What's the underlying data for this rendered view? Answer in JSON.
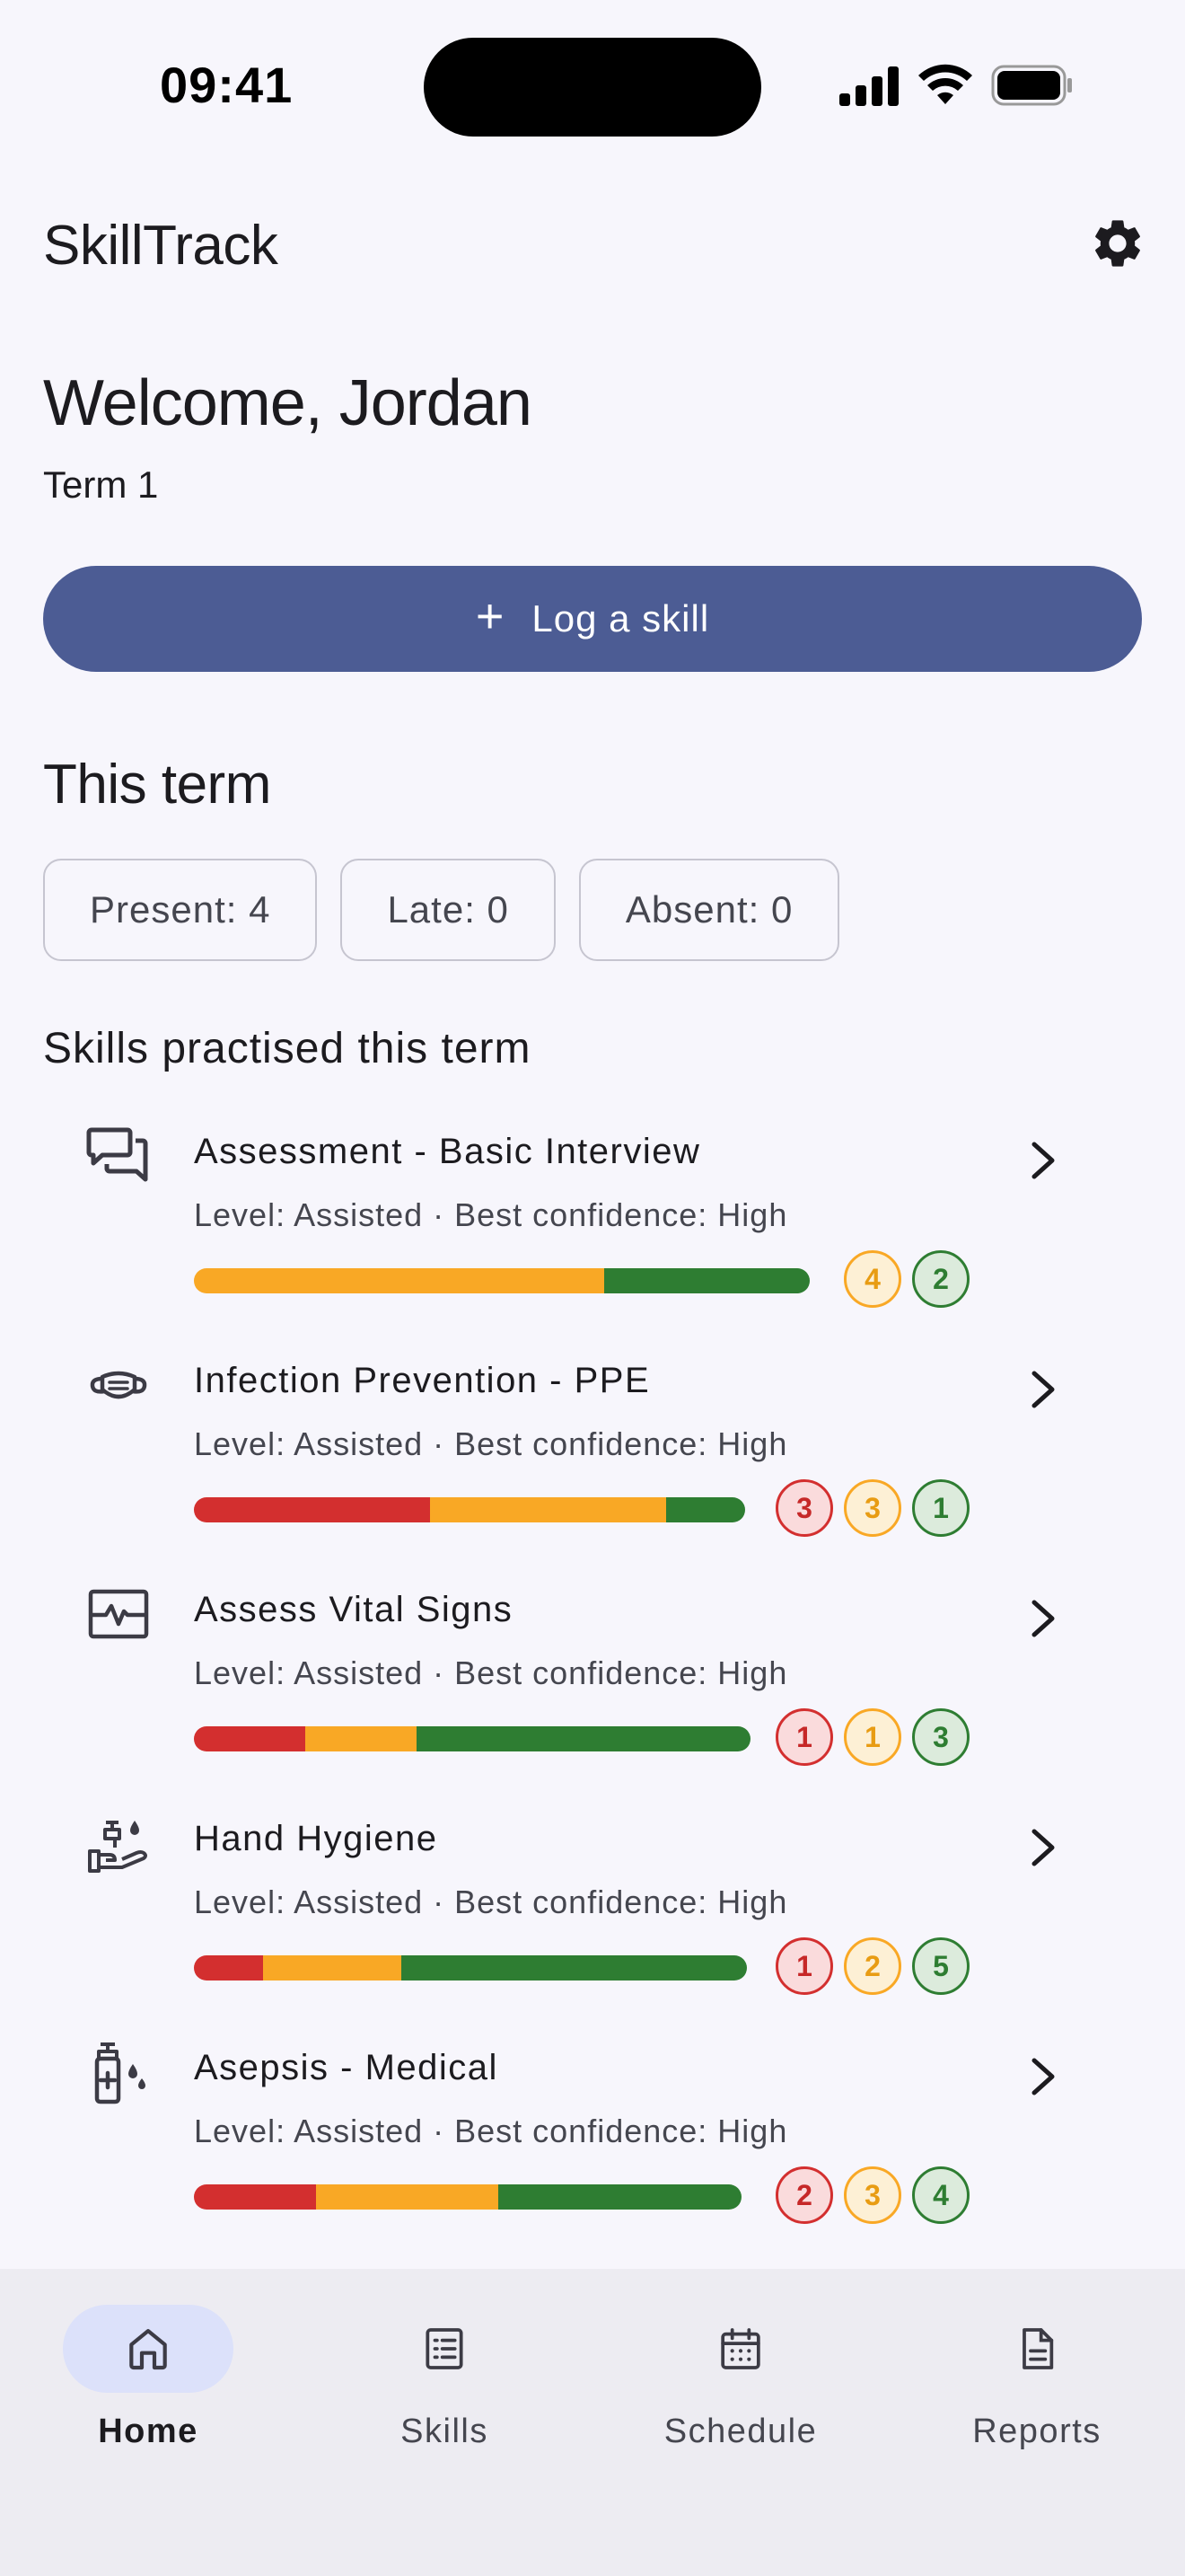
{
  "status_bar": {
    "time": "09:41"
  },
  "app_bar": {
    "title": "SkillTrack",
    "settings_icon": "gear-icon"
  },
  "welcome": {
    "heading": "Welcome, Jordan",
    "term": "Term 1"
  },
  "log_button": {
    "label": "Log a skill",
    "icon": "+"
  },
  "this_term": {
    "title": "This term",
    "chips": [
      "Present: 4",
      "Late: 0",
      "Absent: 0"
    ]
  },
  "skills_section": {
    "title": "Skills practised this term",
    "items": [
      {
        "name": "Assessment - Basic Interview",
        "meta": "Level: Assisted · Best confidence: High",
        "icon": "chat-bubbles-icon",
        "counts": {
          "red": 0,
          "orange": 4,
          "green": 2
        }
      },
      {
        "name": "Infection Prevention - PPE",
        "meta": "Level: Assisted · Best confidence: High",
        "icon": "face-mask-icon",
        "counts": {
          "red": 3,
          "orange": 3,
          "green": 1
        }
      },
      {
        "name": "Assess Vital Signs",
        "meta": "Level: Assisted · Best confidence: High",
        "icon": "vital-signs-monitor-icon",
        "counts": {
          "red": 1,
          "orange": 1,
          "green": 3
        }
      },
      {
        "name": "Hand Hygiene",
        "meta": "Level: Assisted · Best confidence: High",
        "icon": "hand-wash-icon",
        "counts": {
          "red": 1,
          "orange": 2,
          "green": 5
        }
      },
      {
        "name": "Asepsis - Medical",
        "meta": "Level: Assisted · Best confidence: High",
        "icon": "sanitizer-bottle-icon",
        "counts": {
          "red": 2,
          "orange": 3,
          "green": 4
        }
      }
    ]
  },
  "bottom_nav": {
    "items": [
      {
        "label": "Home",
        "icon": "home-icon",
        "active": true
      },
      {
        "label": "Skills",
        "icon": "list-icon",
        "active": false
      },
      {
        "label": "Schedule",
        "icon": "calendar-icon",
        "active": false
      },
      {
        "label": "Reports",
        "icon": "document-icon",
        "active": false
      }
    ]
  },
  "colors": {
    "primary": "#4C5C94",
    "background": "#F7F6FC",
    "low": "#D32F2F",
    "medium": "#F9A825",
    "high": "#2E7D32",
    "nav_active_pill": "#DCE1FA"
  }
}
